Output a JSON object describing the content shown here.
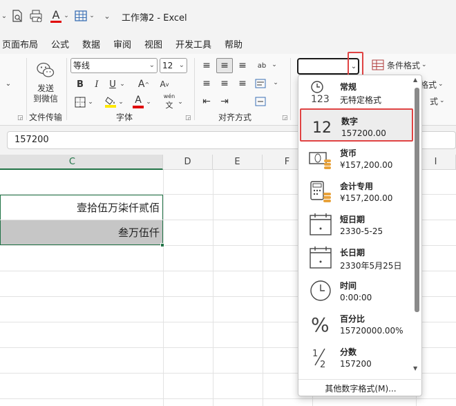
{
  "titlebar": {
    "title": "工作簿2  -  Excel",
    "quick_access": [
      "print-preview-icon",
      "printer-icon",
      "font-color-icon",
      "table-icon",
      "customize-icon"
    ]
  },
  "menu": {
    "tabs": [
      "页面布局",
      "公式",
      "数据",
      "审阅",
      "视图",
      "开发工具",
      "帮助"
    ]
  },
  "ribbon": {
    "send_group": {
      "button_line1": "发送",
      "button_line2": "到微信",
      "label": "文件传输"
    },
    "font_group": {
      "font_name": "等线",
      "font_size": "12",
      "grow_label": "A",
      "shrink_label": "A",
      "bold": "B",
      "italic": "I",
      "underline": "U",
      "font_color_label": "A",
      "phonetic_label": "wén",
      "label": "字体",
      "highlight_color": "#FFE800",
      "font_color": "#E00000"
    },
    "align_group": {
      "label": "对齐方式",
      "orient_label": "ab"
    },
    "number_group": {
      "format_value": ""
    },
    "styles_group": {
      "conditional_format": "条件格式",
      "format_table_partial": "格式",
      "cell_styles_partial": "式"
    }
  },
  "formula_bar": {
    "value": "157200"
  },
  "grid": {
    "columns": [
      "C",
      "D",
      "E",
      "F",
      "I"
    ],
    "selected_column": "C",
    "cells": {
      "c1": "壹拾伍万柒仟贰佰",
      "c2": "叁万伍仟"
    }
  },
  "number_format_menu": {
    "items": [
      {
        "icon": "general-123-icon",
        "name": "常规",
        "example": "无特定格式"
      },
      {
        "icon": "number-12-icon",
        "name": "数字",
        "example": "157200.00"
      },
      {
        "icon": "currency-icon",
        "name": "货币",
        "example": "¥157,200.00"
      },
      {
        "icon": "accounting-icon",
        "name": "会计专用",
        "example": " ¥157,200.00"
      },
      {
        "icon": "calendar-icon",
        "name": "短日期",
        "example": "2330-5-25"
      },
      {
        "icon": "calendar-icon",
        "name": "长日期",
        "example": "2330年5月25日"
      },
      {
        "icon": "clock-icon",
        "name": "时间",
        "example": "0:00:00"
      },
      {
        "icon": "percent-icon",
        "name": "百分比",
        "example": "15720000.00%"
      },
      {
        "icon": "fraction-icon",
        "name": "分数",
        "example": "157200"
      }
    ],
    "selected_index": 1,
    "more_formats": "其他数字格式(M)..."
  },
  "colors": {
    "accent_green": "#217346",
    "highlight_red": "#E04343",
    "selected_cell_fill": "#C6C6C6"
  }
}
